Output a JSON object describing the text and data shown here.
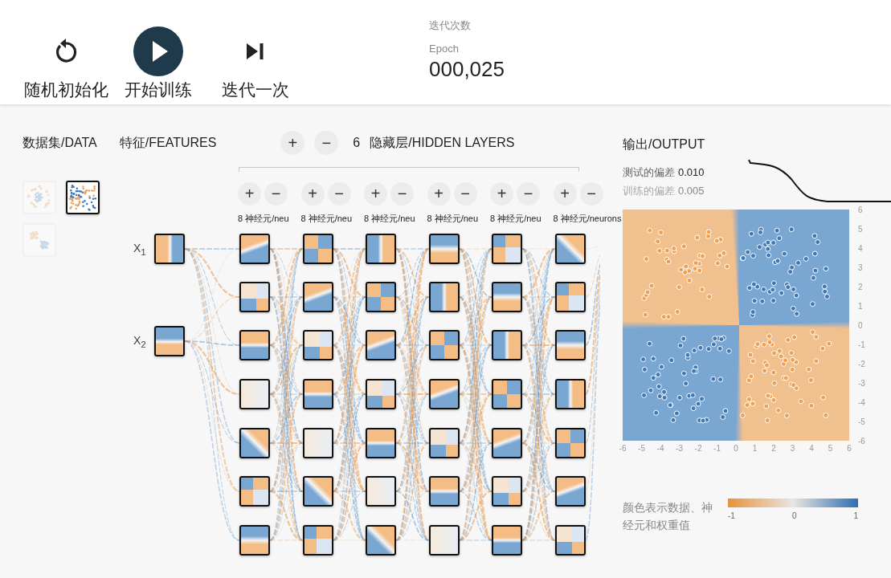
{
  "toolbar": {
    "buttons": [
      {
        "kind": "reset",
        "label": "随机初始化"
      },
      {
        "kind": "play",
        "label": "开始训练"
      },
      {
        "kind": "step",
        "label": "迭代一次"
      }
    ]
  },
  "epoch": {
    "label_zh": "迭代次数",
    "label": "Epoch",
    "value": "000,025"
  },
  "data": {
    "title": "数据集/DATA",
    "datasets": [
      {
        "kind": "circle",
        "selected": false
      },
      {
        "kind": "xor",
        "selected": true
      },
      {
        "kind": "gauss",
        "selected": false
      }
    ]
  },
  "features": {
    "title": "特征/FEATURES",
    "inputs": [
      {
        "label": "X$_{1}$",
        "kind": "vertical"
      },
      {
        "label": "X$_{2}$",
        "kind": "horizontal"
      }
    ]
  },
  "hidden_layers": {
    "add": "+",
    "remove": "−",
    "count": "6",
    "title": "隐藏层/HIDDEN LAYERS",
    "layers": [
      {
        "add": "+",
        "remove": "−",
        "neurons": "8 神经元/neu"
      },
      {
        "add": "+",
        "remove": "−",
        "neurons": "8 神经元/neu"
      },
      {
        "add": "+",
        "remove": "−",
        "neurons": "8 神经元/neu"
      },
      {
        "add": "+",
        "remove": "−",
        "neurons": "8 神经元/neu"
      },
      {
        "add": "+",
        "remove": "−",
        "neurons": "8 神经元/neu"
      },
      {
        "add": "+",
        "remove": "−",
        "neurons": "8 神经元/neurons"
      }
    ]
  },
  "output": {
    "title": "输出/OUTPUT",
    "losses": [
      {
        "kind": "test",
        "label": "测试的偏差",
        "value": "0.010"
      },
      {
        "kind": "train",
        "label": "训练的偏差",
        "value": "0.005"
      }
    ],
    "y_ticks": [
      "6",
      "5",
      "4",
      "3",
      "2",
      "1",
      "0",
      "-1",
      "-2",
      "-3",
      "-4",
      "-5",
      "-6"
    ],
    "x_ticks": [
      "-6",
      "-5",
      "-4",
      "-3",
      "-2",
      "-1",
      "0",
      "1",
      "2",
      "3",
      "4",
      "5",
      "6"
    ],
    "legend": {
      "text": "颜色表示数据、神经元和权重值",
      "ticks": [
        "-1",
        "0",
        "1"
      ]
    }
  }
}
